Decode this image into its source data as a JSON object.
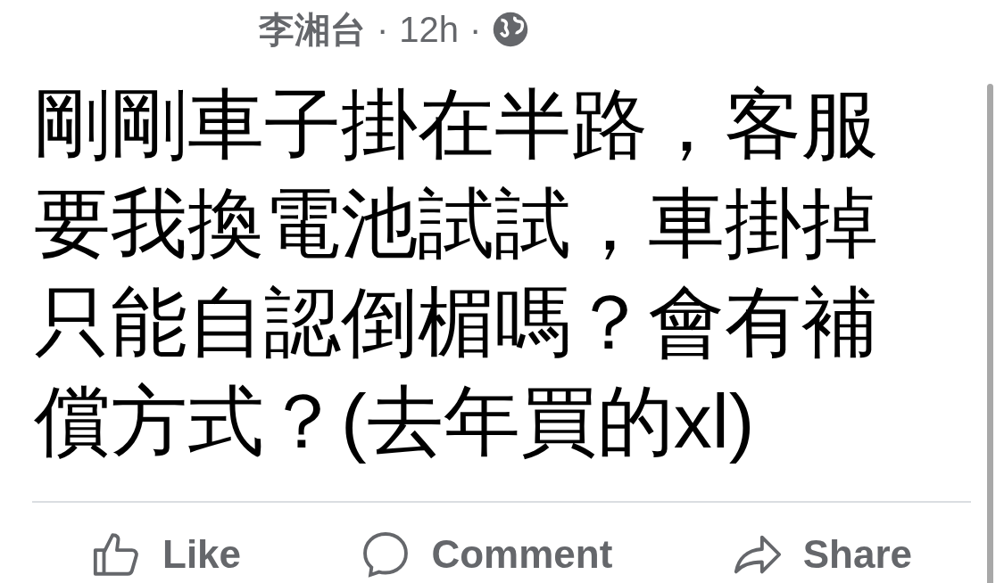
{
  "post": {
    "author": "李湘台",
    "separator_1": "·",
    "time": "12h",
    "separator_2": "·",
    "text": "剛剛車子掛在半路，客服要我換電池試試，車掛掉只能自認倒楣嗎？會有補償方式？(去年買的xl)"
  },
  "actions": [
    {
      "kind": "like",
      "label": "Like"
    },
    {
      "kind": "comment",
      "label": "Comment"
    },
    {
      "kind": "share",
      "label": "Share"
    }
  ]
}
